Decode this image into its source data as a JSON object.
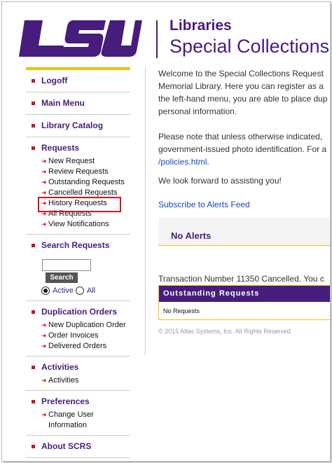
{
  "header": {
    "logo_text": "LSU",
    "libraries": "Libraries",
    "special_collections": "Special Collections"
  },
  "sidebar": {
    "logoff": "Logoff",
    "main_menu": "Main Menu",
    "library_catalog": "Library Catalog",
    "requests": {
      "title": "Requests",
      "items": [
        "New Request",
        "Review Requests",
        "Outstanding Requests",
        "Cancelled Requests",
        "History Requests",
        "All Requests",
        "View Notifications"
      ]
    },
    "search": {
      "title": "Search Requests",
      "input_value": "",
      "button": "Search",
      "radio_active": "Active",
      "radio_all": "All",
      "selected": "Active"
    },
    "duplication": {
      "title": "Duplication Orders",
      "items": [
        "New Duplication Order",
        "Order Invoices",
        "Delivered Orders"
      ]
    },
    "activities": {
      "title": "Activities",
      "items": [
        "Activities"
      ]
    },
    "preferences": {
      "title": "Preferences",
      "items": [
        "Change User Information"
      ]
    },
    "about": "About SCRS"
  },
  "main": {
    "welcome_lines": [
      "Welcome to the Special Collections Request",
      "Memorial Library. Here you can register as a",
      "the left-hand menu, you are able to place dup",
      "personal information."
    ],
    "note_lines": [
      "Please note that unless otherwise indicated,",
      "government-issued photo identification. For a"
    ],
    "policies_link": "/policies.html",
    "policies_suffix": ".",
    "look_forward": "We look forward to assisting you!",
    "subscribe_link": "Subscribe to Alerts Feed",
    "alerts_title": "No Alerts",
    "transaction": "Transaction Number 11350 Cancelled. You c",
    "outstanding_header": "Outstanding Requests",
    "outstanding_empty": "No Requests",
    "copyright": "© 2015 Atlas Systems, Inc. All Rights Reserved."
  },
  "colors": {
    "purple": "#461d7c",
    "gold": "#f1c10d",
    "red": "#c8102e",
    "link": "#1a47c0"
  }
}
